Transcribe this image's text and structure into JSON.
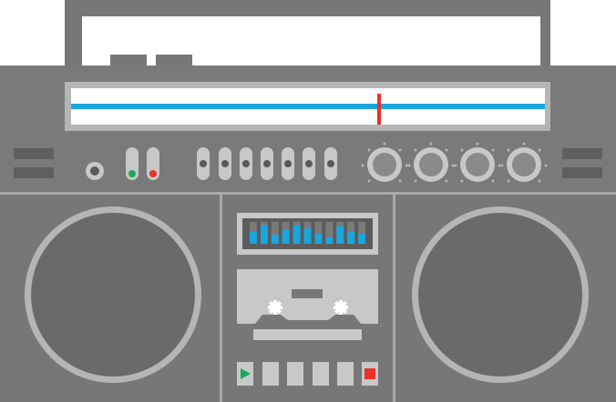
{
  "colors": {
    "body": "#777777",
    "panel_light": "#c8c8c8",
    "tuner_band": "#1aa7e0",
    "tuner_needle": "#e8322b",
    "led_green": "#1aa95a",
    "led_red": "#e8322b",
    "eq_bar": "#1aa7e0",
    "play": "#1aa95a",
    "stop": "#e8322b"
  },
  "tuner": {
    "needle_position": 0.65
  },
  "equalizer": {
    "levels": [
      0.55,
      0.85,
      0.4,
      0.65,
      0.85,
      0.7,
      0.45,
      0.3,
      0.8,
      0.55,
      0.45
    ]
  },
  "transport": {
    "buttons": [
      {
        "name": "play-button",
        "icon": "play-icon"
      },
      {
        "name": "transport-button-2",
        "icon": "none"
      },
      {
        "name": "transport-button-3",
        "icon": "none"
      },
      {
        "name": "transport-button-4",
        "icon": "none"
      },
      {
        "name": "transport-button-5",
        "icon": "none"
      },
      {
        "name": "stop-button",
        "icon": "stop-icon"
      }
    ]
  }
}
